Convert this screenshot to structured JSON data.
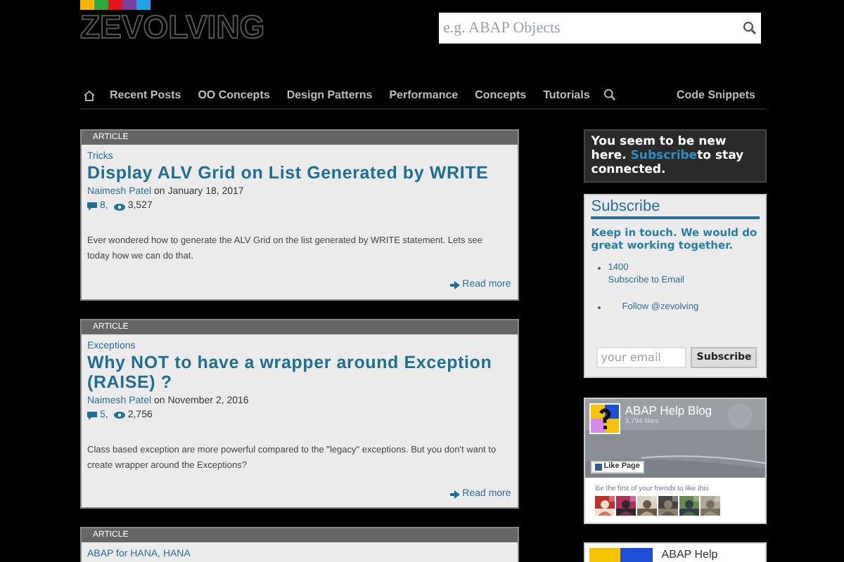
{
  "header": {
    "logo": "ZEVOLVING",
    "logo_stripes": [
      {
        "color": "#f7b500"
      },
      {
        "color": "#2eaa3a"
      },
      {
        "color": "#e8141b"
      },
      {
        "color": "#7a3fa0"
      },
      {
        "color": "#1ea7e8"
      }
    ],
    "search": {
      "placeholder": "e.g. ABAP Objects"
    }
  },
  "nav": {
    "items": [
      "Recent Posts",
      "OO Concepts",
      "Design Patterns",
      "Performance",
      "Concepts",
      "Tutorials"
    ],
    "right": "Code Snippets"
  },
  "articles": [
    {
      "label": "ARTICLE",
      "category": "Tricks",
      "title": "Display ALV Grid on List Generated by WRITE",
      "author": "Naimesh Patel",
      "date": "on January 18, 2017",
      "comments": "8,",
      "views": "3,527",
      "excerpt": "Ever wondered how to generate the ALV Grid on the list generated by WRITE statement. Lets see today how we can do that.",
      "read_more": "Read more"
    },
    {
      "label": "ARTICLE",
      "category": "Exceptions",
      "title": "Why NOT to have a wrapper around Exception (RAISE) ?",
      "author": "Naimesh Patel",
      "date": "on November 2, 2016",
      "comments": "5,",
      "views": "2,756",
      "excerpt": "Class based exception are more powerful compared to the \"legacy\" exceptions. But you don't want to create wrapper around the Exceptions?",
      "read_more": "Read more"
    },
    {
      "label": "ARTICLE",
      "category": "ABAP for HANA, HANA"
    }
  ],
  "sidebar": {
    "welcome": {
      "line1": "You seem to be new here.",
      "link": "Subscribe",
      "line2": "to stay connected."
    },
    "subscribe": {
      "title": "Subscribe",
      "tagline": "Keep in touch. We would do great working together.",
      "items": [
        {
          "count": "1400",
          "text": "Subscribe to Email"
        },
        {
          "text": "Follow @zevolving"
        }
      ],
      "email_placeholder": "your email",
      "button": "Subscribe"
    },
    "fb_box": {
      "name": "ABAP Help Blog",
      "likes": "3,794 likes",
      "like_button": "Like Page",
      "friends_text": "Be the first of your friends to like this"
    },
    "fb_box2": {
      "name": "ABAP Help"
    }
  }
}
